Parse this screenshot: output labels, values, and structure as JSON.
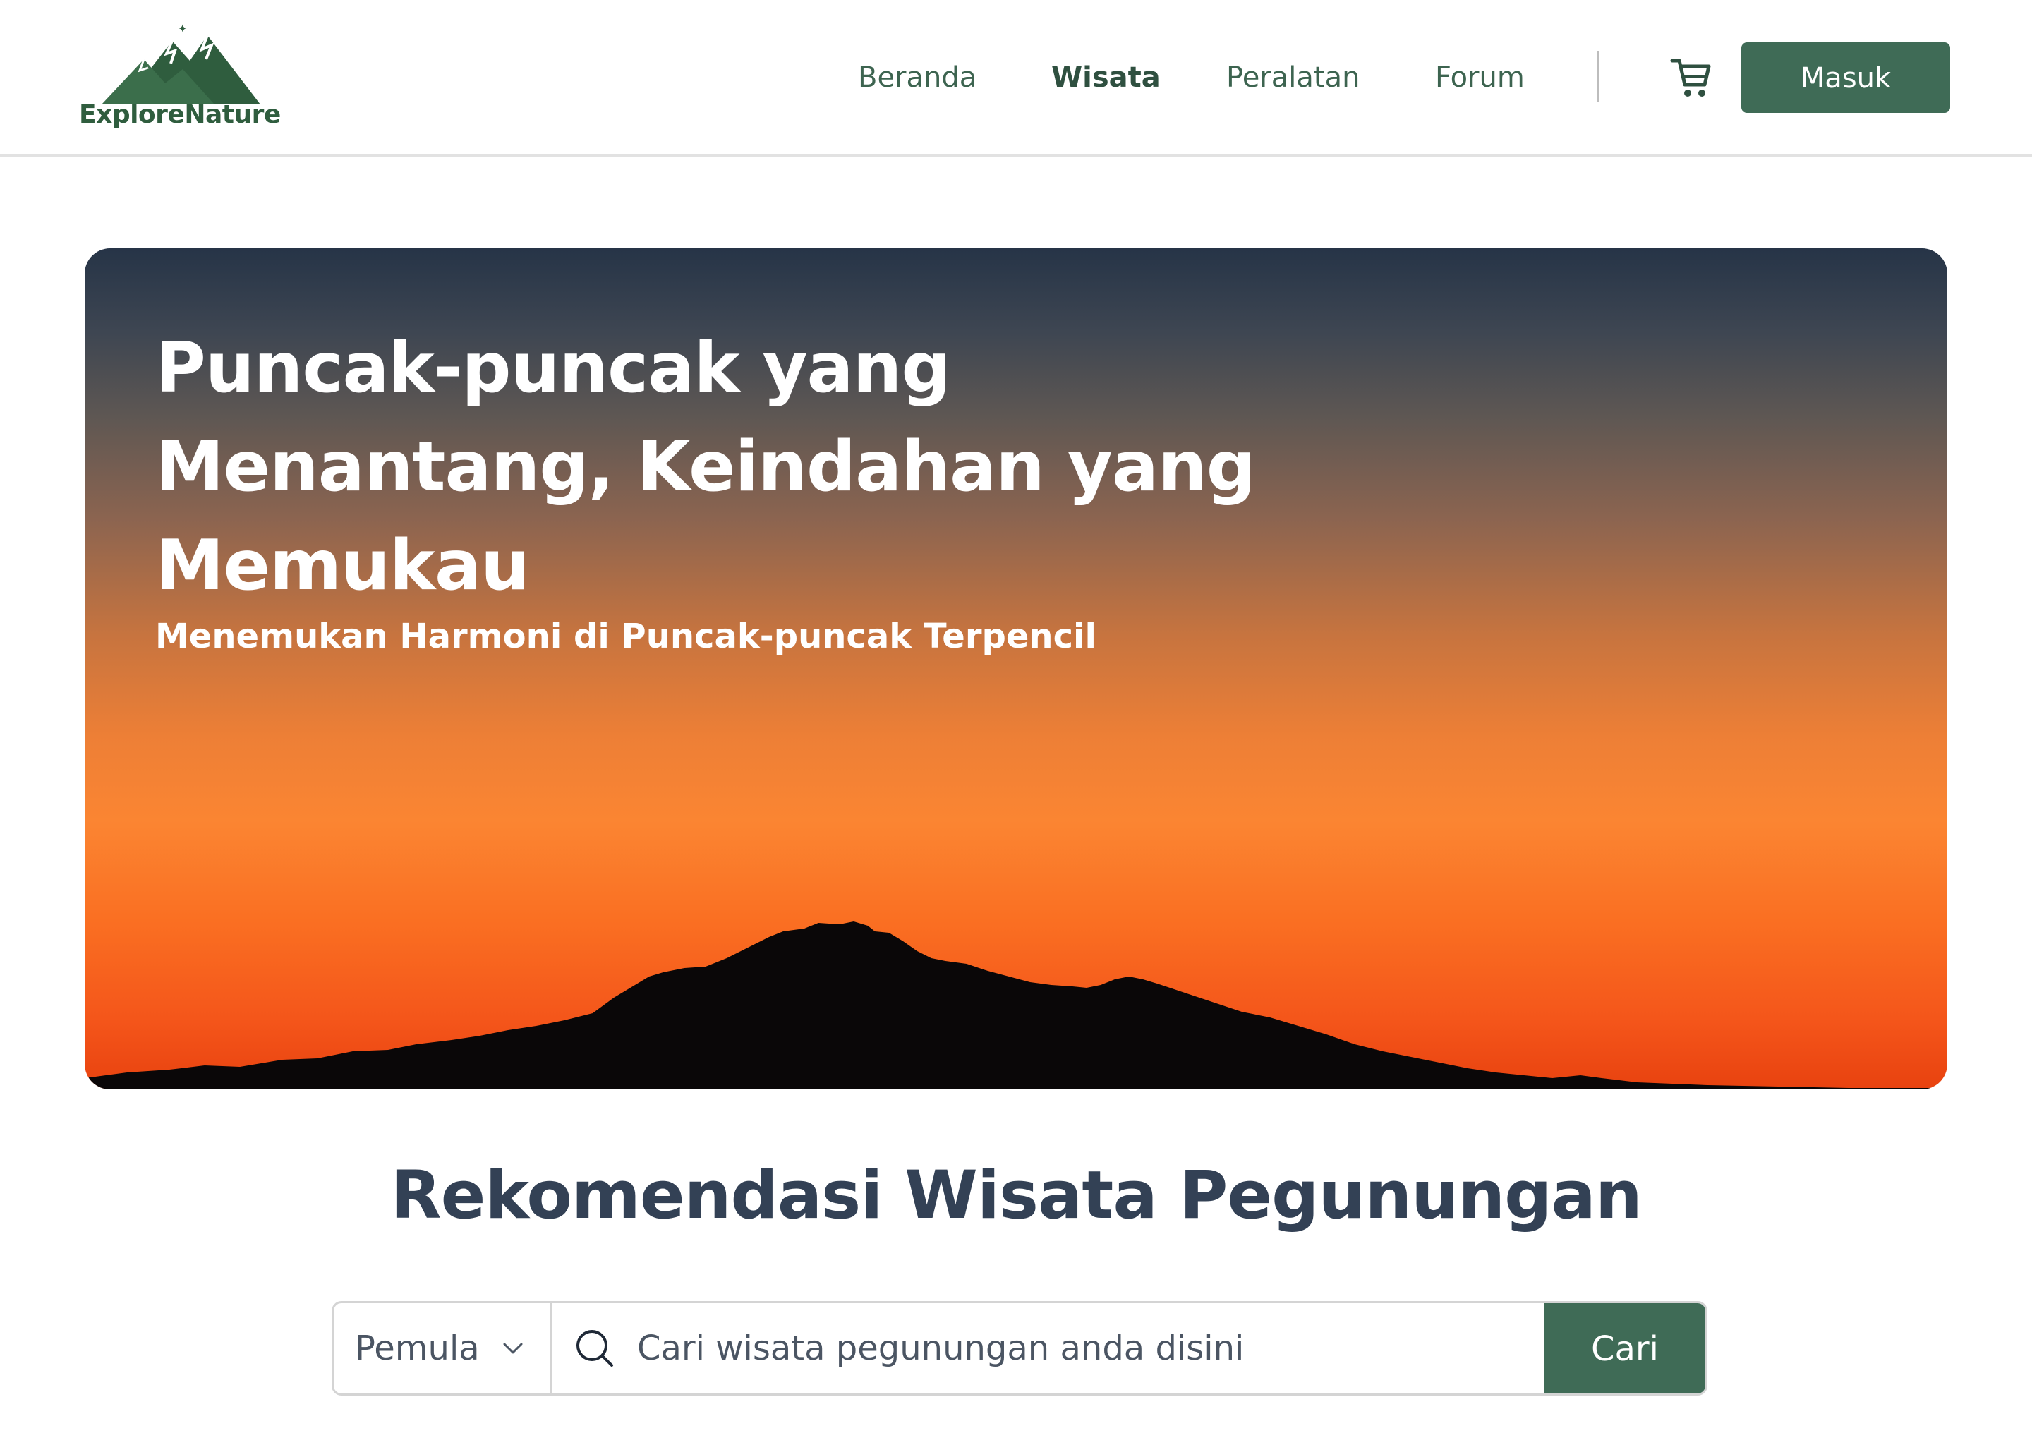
{
  "brand": {
    "name": "ExploreNature",
    "logo_icon": "mountain-logo-icon",
    "color": "#2f5d3e"
  },
  "nav": {
    "items": [
      {
        "label": "Beranda",
        "active": false
      },
      {
        "label": "Wisata",
        "active": true
      },
      {
        "label": "Peralatan",
        "active": false
      },
      {
        "label": "Forum",
        "active": false
      }
    ],
    "cart_icon": "shopping-cart-icon",
    "login_label": "Masuk"
  },
  "hero": {
    "title": "Puncak-puncak yang Menantang, Keindahan yang Memukau",
    "subtitle": "Menemukan Harmoni di Puncak-puncak Terpencil",
    "image": "sunset-mountain-silhouette"
  },
  "section": {
    "title": "Rekomendasi Wisata Pegunungan"
  },
  "search": {
    "level_selected": "Pemula",
    "placeholder": "Cari wisata pegunungan anda disini",
    "value": "",
    "button_label": "Cari",
    "icon": "search-icon"
  },
  "colors": {
    "accent": "#3f6b56",
    "text_dark": "#334155",
    "nav_text": "#3d6450"
  }
}
